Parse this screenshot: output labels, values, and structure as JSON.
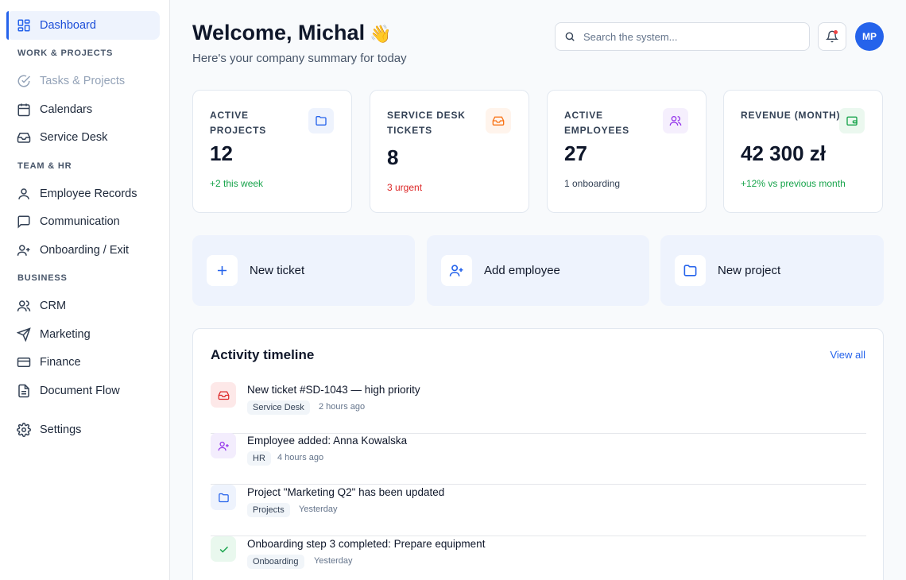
{
  "sidebar": {
    "dashboard": "Dashboard",
    "sections": {
      "work": "WORK & PROJECTS",
      "team": "TEAM & HR",
      "business": "BUSINESS"
    },
    "items": {
      "tasks": "Tasks & Projects",
      "calendars": "Calendars",
      "service_desk": "Service Desk",
      "employee_records": "Employee Records",
      "communication": "Communication",
      "onboarding": "Onboarding / Exit",
      "crm": "CRM",
      "marketing": "Marketing",
      "finance": "Finance",
      "document_flow": "Document Flow",
      "settings": "Settings"
    }
  },
  "header": {
    "welcome": "Welcome, Michal",
    "wave": "👋",
    "subtitle": "Here's your company summary for today",
    "search_placeholder": "Search the system...",
    "avatar_initials": "MP"
  },
  "stats": [
    {
      "label": "ACTIVE PROJECTS",
      "value": "12",
      "note": "+2 this week",
      "icon": "folder-icon"
    },
    {
      "label": "SERVICE DESK TICKETS",
      "value": "8",
      "note": "3 urgent",
      "icon": "inbox-icon"
    },
    {
      "label": "ACTIVE EMPLOYEES",
      "value": "27",
      "note": "1 onboarding",
      "icon": "users-icon"
    },
    {
      "label": "REVENUE (MONTH)",
      "value": "42 300 zł",
      "note": "+12% vs previous month",
      "icon": "wallet-icon"
    }
  ],
  "actions": [
    {
      "label": "New ticket",
      "icon": "plus-icon"
    },
    {
      "label": "Add employee",
      "icon": "user-plus-icon"
    },
    {
      "label": "New project",
      "icon": "folder-icon"
    }
  ],
  "timeline": {
    "title": "Activity timeline",
    "view_all": "View all",
    "items": [
      {
        "text": "New ticket #SD-1043 — high priority",
        "tag": "Service Desk",
        "time": "2 hours ago",
        "icon": "inbox-icon"
      },
      {
        "text": "Employee added: Anna Kowalska",
        "tag": "HR",
        "time": "4 hours ago",
        "icon": "user-plus-icon"
      },
      {
        "text": "Project \"Marketing Q2\" has been updated",
        "tag": "Projects",
        "time": "Yesterday",
        "icon": "folder-icon"
      },
      {
        "text": "Onboarding step 3 completed: Prepare equipment",
        "tag": "Onboarding",
        "time": "Yesterday",
        "icon": "check-icon"
      }
    ]
  },
  "colors": {
    "accent": "#2563eb",
    "positive": "#16a34a",
    "urgent": "#dc2626",
    "purple": "#9333ea",
    "orange": "#f97316"
  }
}
